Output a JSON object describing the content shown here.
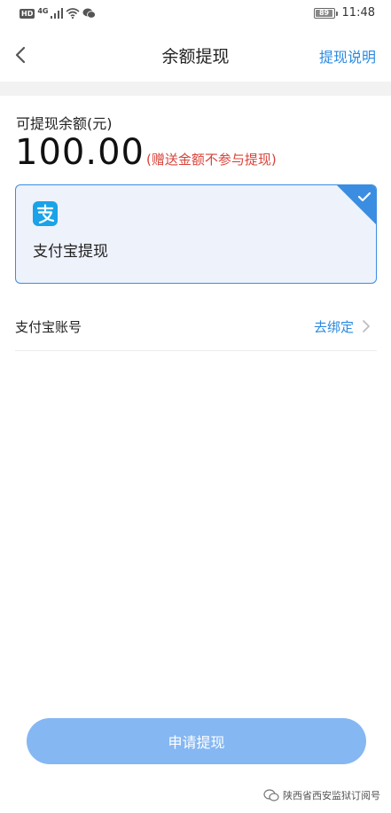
{
  "status_bar": {
    "hd": "HD",
    "network": "4G",
    "battery": "89",
    "time": "11:48"
  },
  "nav": {
    "title": "余额提现",
    "help": "提现说明"
  },
  "balance": {
    "label": "可提现余额(元)",
    "amount": "100.00",
    "note": "(赠送金额不参与提现)"
  },
  "payment_method": {
    "label": "支付宝提现",
    "icon": "alipay-icon",
    "selected": true,
    "accent_color": "#3b8de1"
  },
  "account": {
    "label": "支付宝账号",
    "action": "去绑定"
  },
  "submit": {
    "label": "申请提现",
    "color": "#85b7f3"
  },
  "watermark": {
    "text": "陕西省西安监狱订阅号"
  }
}
